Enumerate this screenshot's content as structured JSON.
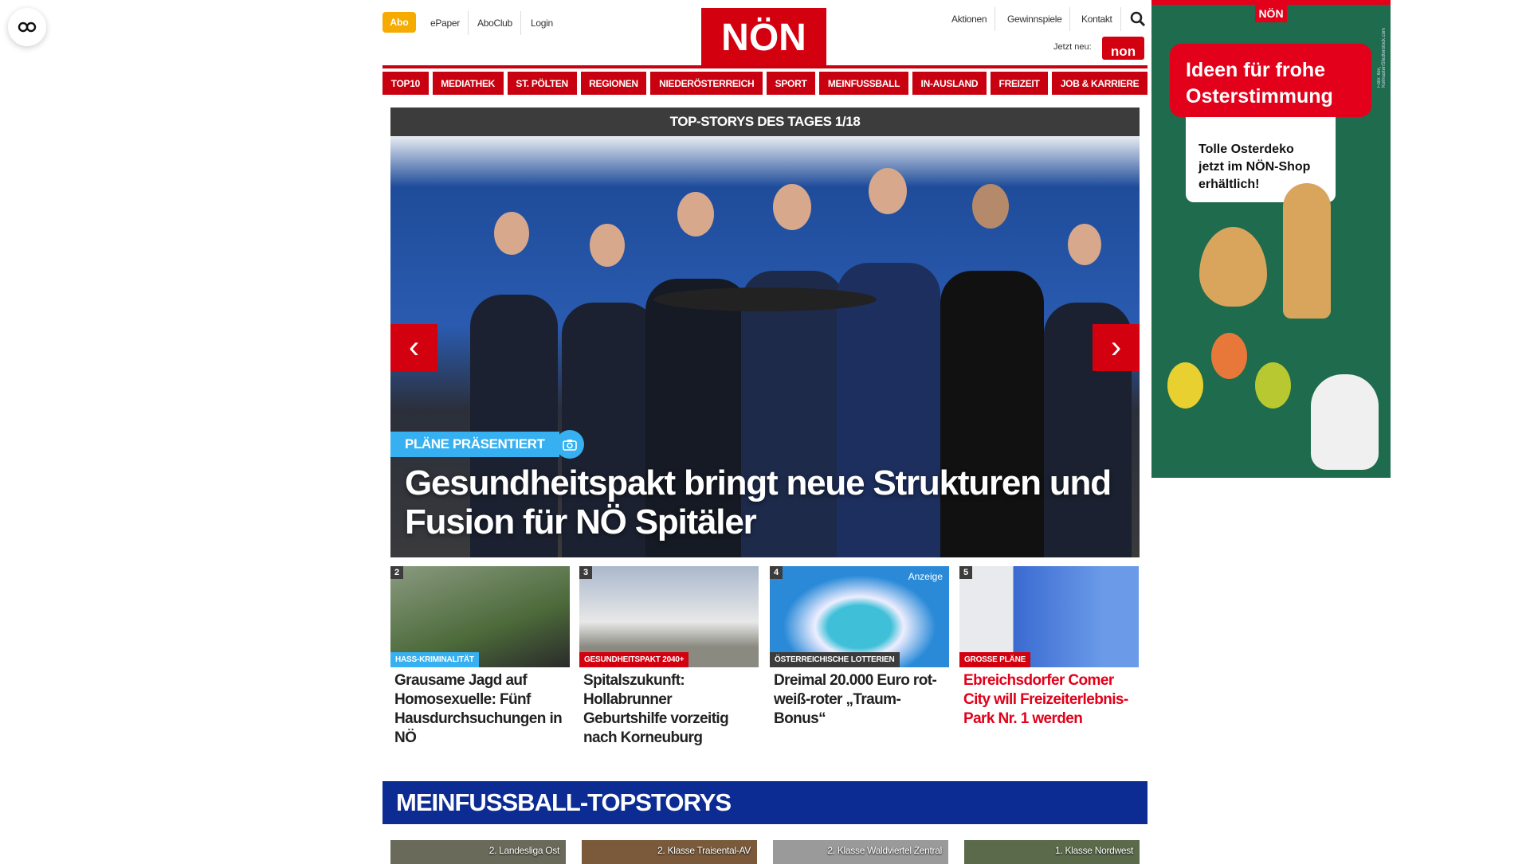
{
  "header": {
    "abo": "Abo",
    "links_left": [
      "ePaper",
      "AboClub",
      "Login"
    ],
    "logo": "NÖN",
    "links_right": [
      "Aktionen",
      "Gewinnspiele",
      "Kontakt"
    ],
    "jetzt_neu": "Jetzt neu:",
    "new_badge": "non"
  },
  "nav": [
    "TOP10",
    "MEDIATHEK",
    "ST. PÖLTEN",
    "REGIONEN",
    "NIEDERÖSTERREICH",
    "SPORT",
    "MEINFUSSBALL",
    "IN-AUSLAND",
    "FREIZEIT",
    "JOB & KARRIERE"
  ],
  "topstories": {
    "title": "TOP-STORYS DES TAGES 1/18",
    "hero": {
      "kicker": "PLÄNE PRÄSENTIERT",
      "title": "Gesundheitspakt bringt neue Strukturen und Fusion für NÖ Spitäler"
    },
    "cards": [
      {
        "num": "2",
        "kicker": "HASS-KRIMINALITÄT",
        "kicker_color": "#36b0f0",
        "title": "Grausame Jagd auf Homosexuelle: Fünf Hausdurchsuchungen in NÖ",
        "title_color": "#222"
      },
      {
        "num": "3",
        "kicker": "GESUNDHEITSPAKT 2040+",
        "kicker_color": "#d3000f",
        "title": "Spitalszukunft: Hollabrunner Geburtshilfe vorzeitig nach Korneuburg",
        "title_color": "#222"
      },
      {
        "num": "4",
        "badge": "Anzeige",
        "kicker": "ÖSTERREICHISCHE LOTTERIEN",
        "kicker_color": "#3c3c3c",
        "title": "Dreimal 20.000 Euro rot-weiß-roter „Traum-Bonus“",
        "title_color": "#222"
      },
      {
        "num": "5",
        "kicker": "GROSSE PLÄNE",
        "kicker_color": "#d3000f",
        "title": "Ebreichsdorfer Comer City will Freizeiterlebnis-Park Nr. 1 werden",
        "title_color": "#e2001a"
      }
    ]
  },
  "meinfussball": {
    "title": "MEINFUSSBALL-TOPSTORYS",
    "thumbs": [
      "2. Landesliga Ost",
      "2. Klasse Traisental-AV",
      "2. Klasse Waldviertel Zentral",
      "1. Klasse Nordwest"
    ]
  },
  "ad": {
    "logo": "NÖN",
    "headline": "Ideen für frohe Osterstimmung",
    "sub": "Tolle Osterdeko jetzt im NÖN-Shop erhältlich!",
    "credit": "Foto: Ilex, Kolmaster/Shutterstock.com"
  }
}
